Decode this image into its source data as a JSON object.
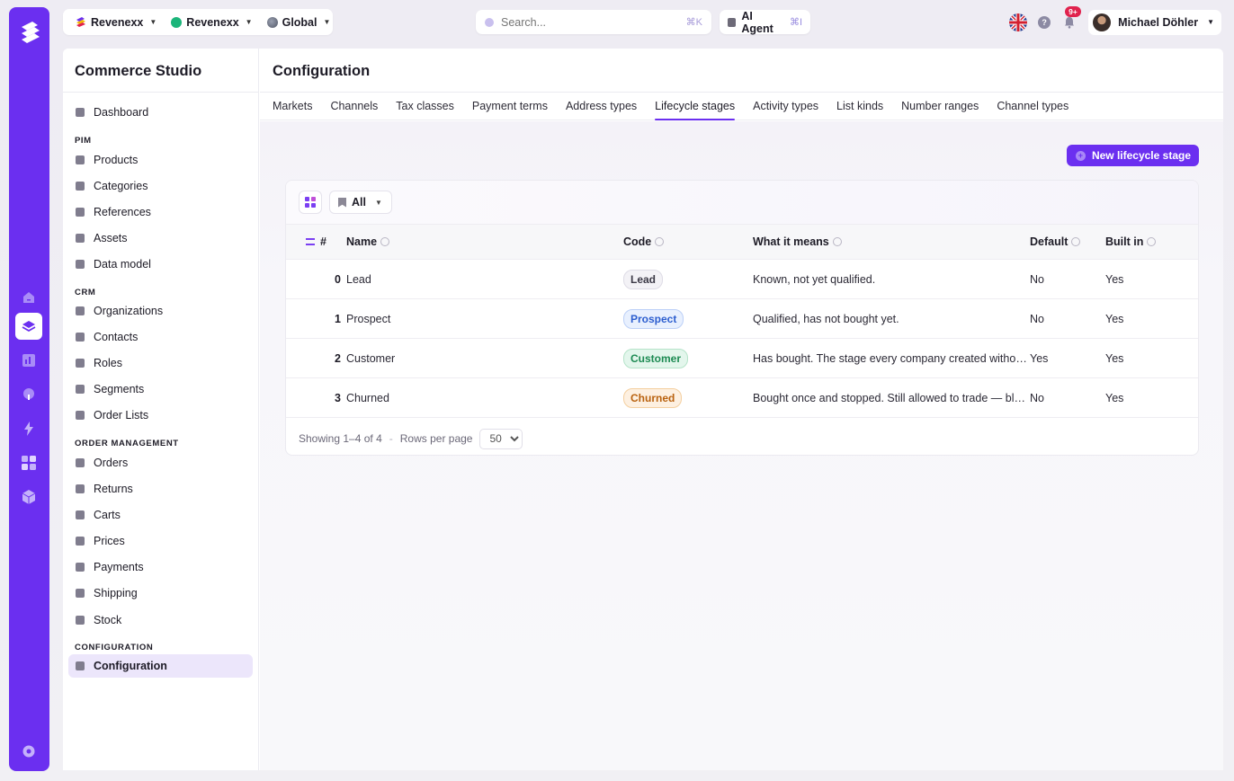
{
  "rail": {
    "items": [
      "home-icon",
      "layers-icon",
      "chart-icon",
      "bulb-icon",
      "bolt-icon",
      "apps-icon",
      "cube-icon"
    ],
    "settings_icon": "gear-icon"
  },
  "topbar": {
    "contexts": [
      {
        "label": "Revenexx",
        "icon": "revenexx-logo-icon"
      },
      {
        "label": "Revenexx",
        "icon": "green-dot-icon"
      },
      {
        "label": "Global",
        "icon": "globe-icon"
      }
    ],
    "search": {
      "placeholder": "Search...",
      "shortcut": "⌘K"
    },
    "ai_agent": {
      "label": "AI Agent",
      "shortcut": "⌘I"
    },
    "notifications_badge": "9+",
    "user_name": "Michael Döhler"
  },
  "sidebar": {
    "title": "Commerce Studio",
    "dashboard": "Dashboard",
    "sections": [
      {
        "title": "PIM",
        "items": [
          "Products",
          "Categories",
          "References",
          "Assets",
          "Data model"
        ]
      },
      {
        "title": "CRM",
        "items": [
          "Organizations",
          "Contacts",
          "Roles",
          "Segments",
          "Order Lists"
        ]
      },
      {
        "title": "ORDER MANAGEMENT",
        "items": [
          "Orders",
          "Returns",
          "Carts",
          "Prices",
          "Payments",
          "Shipping",
          "Stock"
        ]
      },
      {
        "title": "CONFIGURATION",
        "items": [
          "Configuration"
        ]
      }
    ]
  },
  "main": {
    "title": "Configuration",
    "tabs": [
      "Markets",
      "Channels",
      "Tax classes",
      "Payment terms",
      "Address types",
      "Lifecycle stages",
      "Activity types",
      "List kinds",
      "Number ranges",
      "Channel types"
    ],
    "active_tab": "Lifecycle stages",
    "new_button": "New lifecycle stage",
    "filter": "All",
    "columns": {
      "num": "#",
      "name": "Name",
      "code": "Code",
      "meaning": "What it means",
      "default": "Default",
      "builtin": "Built in"
    },
    "rows": [
      {
        "num": "0",
        "name": "Lead",
        "code": "Lead",
        "meaning": "Known, not yet qualified.",
        "default": "No",
        "builtin": "Yes"
      },
      {
        "num": "1",
        "name": "Prospect",
        "code": "Prospect",
        "meaning": "Qualified, has not bought yet.",
        "default": "No",
        "builtin": "Yes"
      },
      {
        "num": "2",
        "name": "Customer",
        "code": "Customer",
        "meaning": "Has bought. The stage every company created without…",
        "default": "Yes",
        "builtin": "Yes"
      },
      {
        "num": "3",
        "name": "Churned",
        "code": "Churned",
        "meaning": "Bought once and stopped. Still allowed to trade — bloc…",
        "default": "No",
        "builtin": "Yes"
      }
    ],
    "footer": {
      "showing": "Showing 1–4 of 4",
      "sep": "-",
      "rows_per_page": "Rows per page",
      "page_size": "50"
    }
  },
  "colors": {
    "accent": "#6b2ff0",
    "prospect": "#2c5ecf",
    "customer": "#1c8a52",
    "churned": "#b9620f"
  }
}
